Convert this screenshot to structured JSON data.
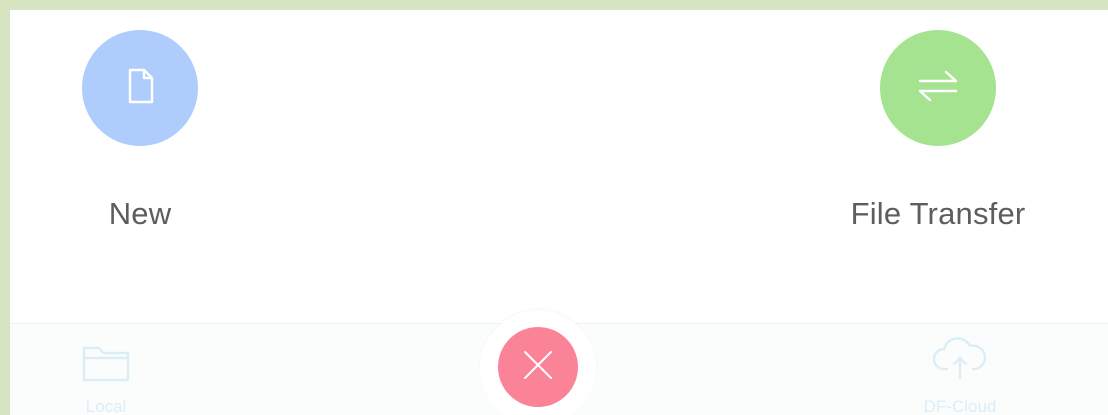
{
  "actions": {
    "new": {
      "label": "New",
      "color": "#aecdfc",
      "icon": "document-icon"
    },
    "file_transfer": {
      "label": "File Transfer",
      "color": "#a6e390",
      "icon": "swap-arrows-icon"
    }
  },
  "tabbar": {
    "local": {
      "label": "Local",
      "icon": "folder-icon"
    },
    "cloud": {
      "label": "DF-Cloud",
      "icon": "cloud-upload-icon"
    },
    "close": {
      "icon": "close-icon",
      "color": "#fb8397"
    }
  }
}
